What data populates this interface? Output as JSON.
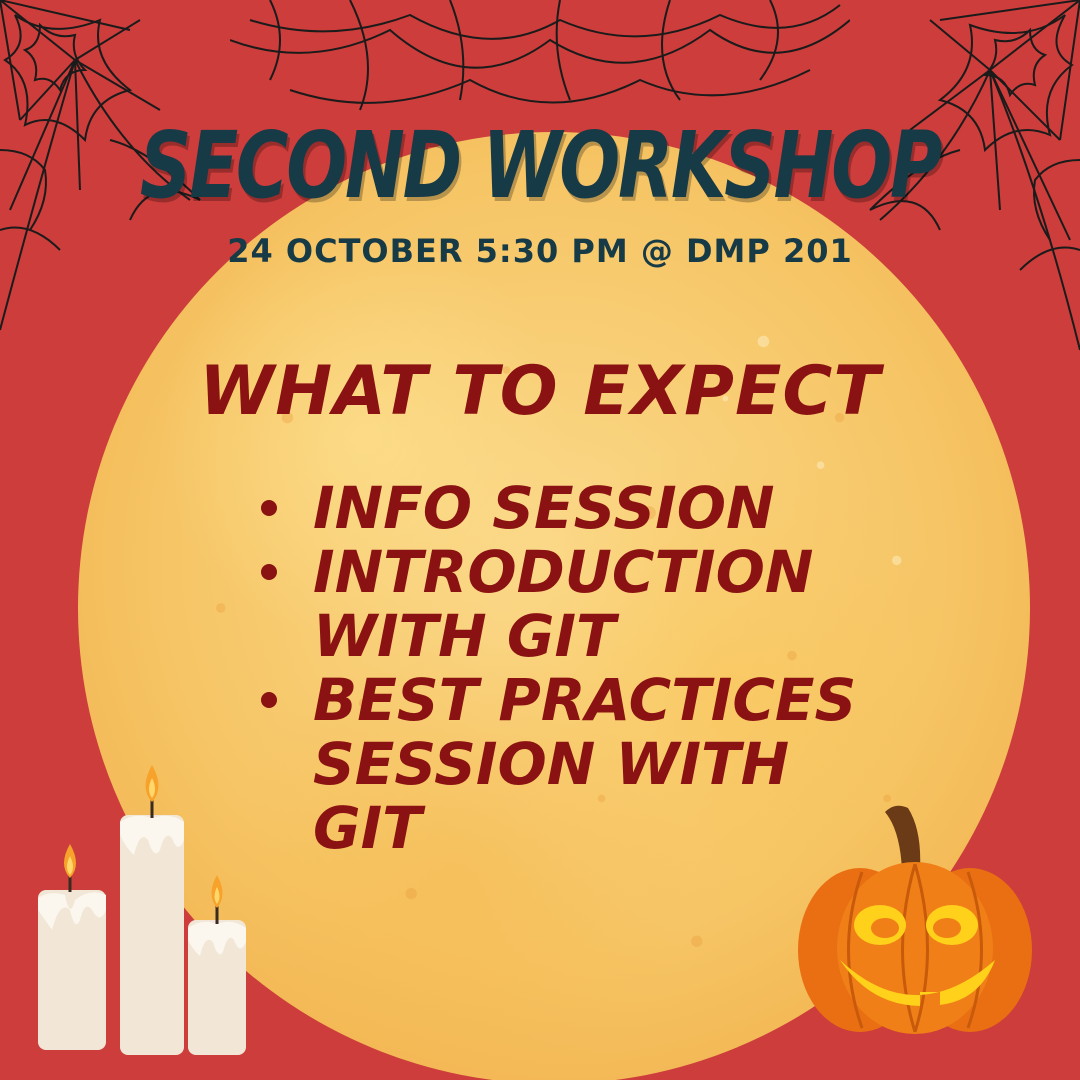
{
  "poster": {
    "title": "SECOND WORKSHOP",
    "subtitle": "24 OCTOBER 5:30 PM @ DMP 201",
    "section_title": "WHAT TO EXPECT",
    "items": [
      {
        "lines": [
          "INFO SESSION"
        ]
      },
      {
        "lines": [
          "INTRODUCTION",
          "WITH GIT"
        ]
      },
      {
        "lines": [
          "BEST PRACTICES",
          "SESSION WITH",
          "GIT"
        ]
      }
    ]
  },
  "colors": {
    "background": "#cc3d3b",
    "title": "#173a47",
    "body_text": "#8a1212",
    "moon": "#f6c565"
  },
  "decorations": [
    "spider-web-icon",
    "moon-icon",
    "candles-icon",
    "jack-o-lantern-icon"
  ]
}
